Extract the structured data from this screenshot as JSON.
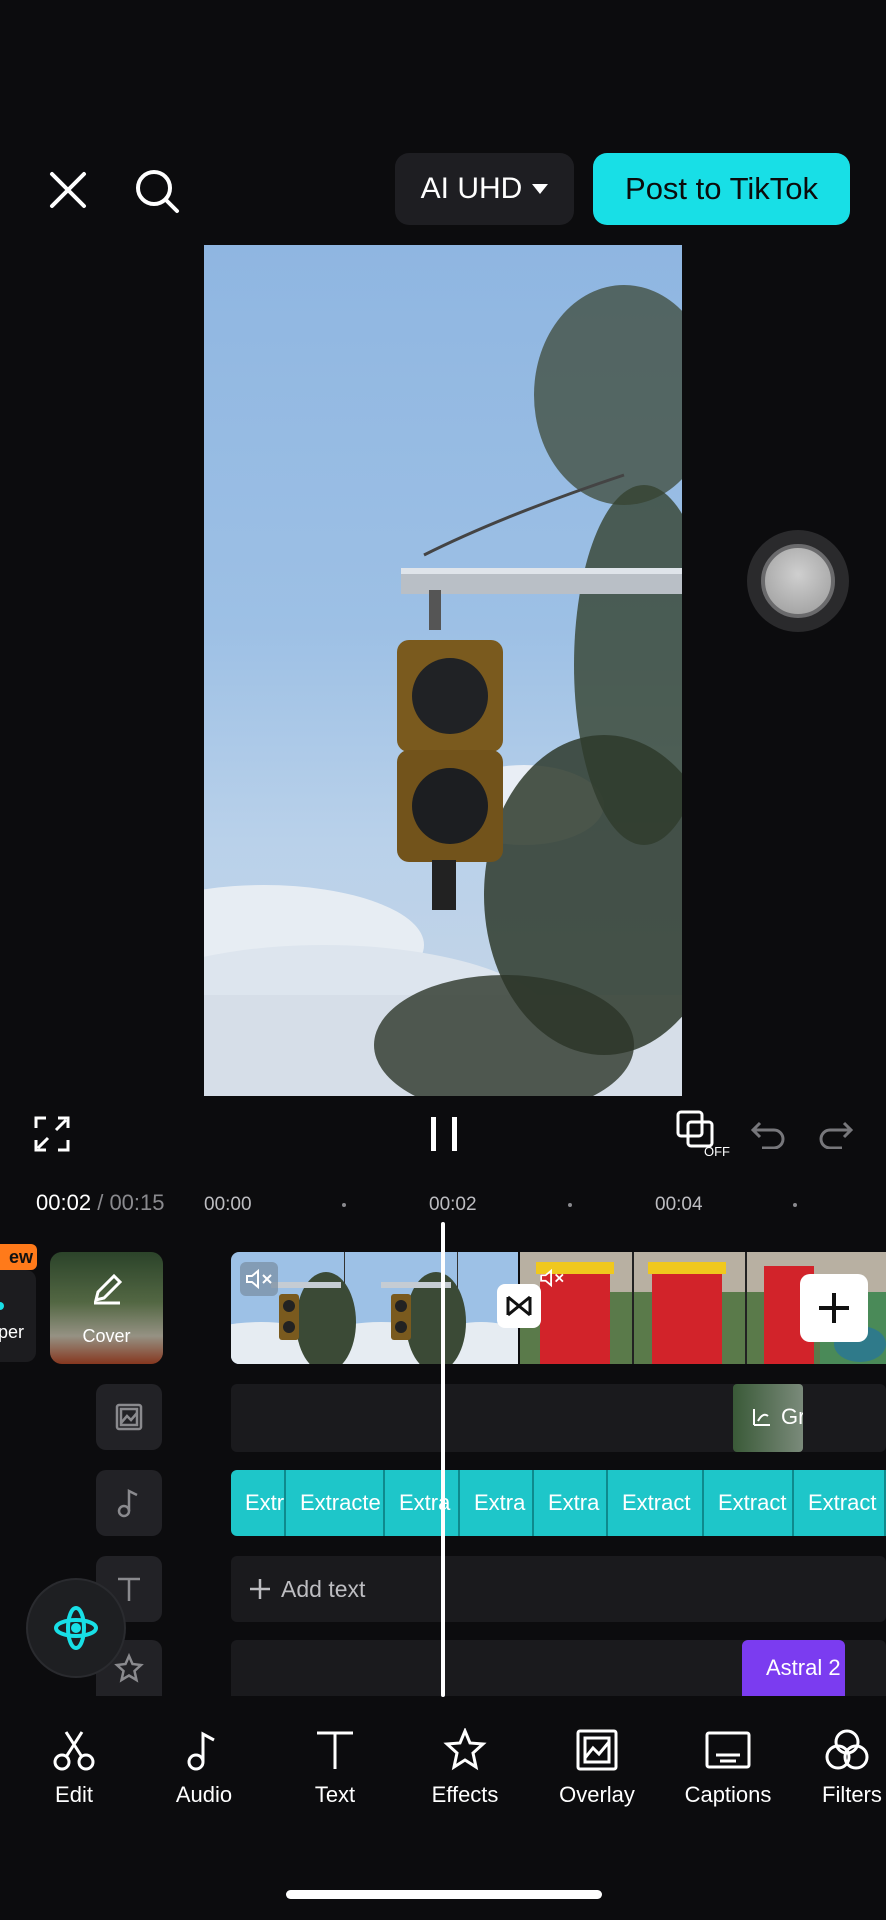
{
  "header": {
    "quality_label": "AI UHD",
    "post_button": "Post to TikTok"
  },
  "timeline": {
    "current_time": "00:02",
    "separator": "/",
    "total_time": "00:15",
    "ruler": [
      "00:00",
      "00:02",
      "00:04"
    ],
    "cover_label": "Cover",
    "new_badge": "ew",
    "side_label": "per",
    "overlay_clip_label": "Gr",
    "audio_segments": [
      "Extr",
      "Extracte",
      "Extra",
      "Extra",
      "Extra",
      "Extract",
      "Extract",
      "Extract"
    ],
    "add_text_label": "Add text",
    "effect_label": "Astral 2"
  },
  "toolbar": {
    "items": [
      {
        "label": "Edit",
        "icon": "scissors-icon"
      },
      {
        "label": "Audio",
        "icon": "music-note-icon"
      },
      {
        "label": "Text",
        "icon": "text-icon"
      },
      {
        "label": "Effects",
        "icon": "star-icon"
      },
      {
        "label": "Overlay",
        "icon": "overlay-icon"
      },
      {
        "label": "Captions",
        "icon": "captions-icon"
      },
      {
        "label": "Filters",
        "icon": "filters-icon"
      }
    ]
  },
  "colors": {
    "accent": "#18dfe6",
    "audio_track": "#1ec6c9",
    "effect_track": "#7b3cf0",
    "badge": "#ff7a1a"
  }
}
